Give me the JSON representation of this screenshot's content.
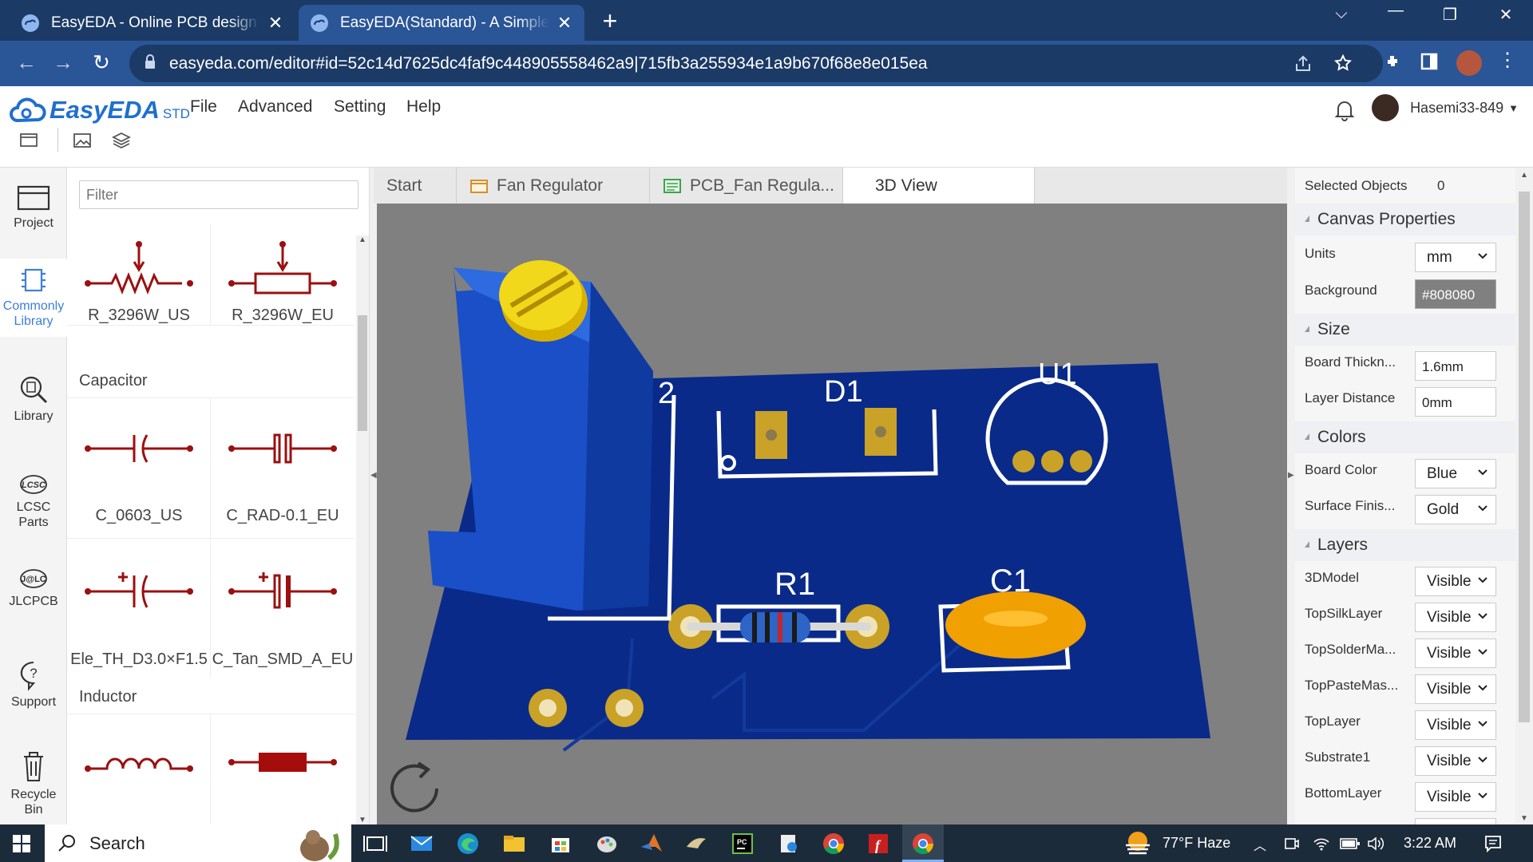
{
  "browser": {
    "tabs": [
      {
        "title": "EasyEDA - Online PCB design & c",
        "close": "✕"
      },
      {
        "title": "EasyEDA(Standard) - A Simple an",
        "close": "✕"
      }
    ],
    "new_tab": "+",
    "url": "easyeda.com/editor#id=52c14d7625dc4faf9c448905558462a9|715fb3a255934e1a9b670f68e8e015ea"
  },
  "app": {
    "logo": "EasyEDA",
    "edition": "STD",
    "menus": [
      "File",
      "Advanced",
      "Setting",
      "Help"
    ],
    "user": "Hasemi33-849"
  },
  "leftnav": [
    {
      "label": "Project",
      "icon": "folder-icon"
    },
    {
      "label": "Commonly Library",
      "icon": "chip-icon"
    },
    {
      "label": "Library",
      "icon": "library-search-icon"
    },
    {
      "label": "LCSC Parts",
      "icon": "lcsc-icon"
    },
    {
      "label": "JLCPCB",
      "icon": "jlcpcb-icon"
    },
    {
      "label": "Support",
      "icon": "help-icon"
    },
    {
      "label": "Recycle Bin",
      "icon": "trash-icon"
    }
  ],
  "library": {
    "filter_placeholder": "Filter",
    "sections": [
      "Capacitor",
      "Inductor"
    ],
    "items": [
      "R_3296W_US",
      "R_3296W_EU",
      "C_0603_US",
      "C_RAD-0.1_EU",
      "Ele_TH_D3.0×F1.5",
      "C_Tan_SMD_A_EU"
    ]
  },
  "doctabs": [
    "Start",
    "Fan Regulator",
    "PCB_Fan Regula...",
    "3D View"
  ],
  "board": {
    "labels": {
      "d1": "D1",
      "u1": "U1",
      "r1": "R1",
      "c1": "C1",
      "r2": "2"
    },
    "colors": {
      "background": "#808080",
      "board": "#0a2a8a",
      "silk": "#ffffff",
      "pad": "#c9a227"
    }
  },
  "props": {
    "selected_label": "Selected Objects",
    "selected_count": "0",
    "canvas_head": "Canvas Properties",
    "units_label": "Units",
    "units_value": "mm",
    "bg_label": "Background",
    "bg_value": "#808080",
    "size_head": "Size",
    "thick_label": "Board Thickn...",
    "thick_value": "1.6mm",
    "dist_label": "Layer Distance",
    "dist_value": "0mm",
    "colors_head": "Colors",
    "board_color_label": "Board Color",
    "board_color_value": "Blue",
    "finish_label": "Surface Finis...",
    "finish_value": "Gold",
    "layers_head": "Layers",
    "layers": [
      {
        "name": "3DModel",
        "value": "Visible"
      },
      {
        "name": "TopSilkLayer",
        "value": "Visible"
      },
      {
        "name": "TopSolderMa...",
        "value": "Visible"
      },
      {
        "name": "TopPasteMas...",
        "value": "Visible"
      },
      {
        "name": "TopLayer",
        "value": "Visible"
      },
      {
        "name": "Substrate1",
        "value": "Visible"
      },
      {
        "name": "BottomLayer",
        "value": "Visible"
      }
    ]
  },
  "taskbar": {
    "search": "Search",
    "weather": "77°F  Haze",
    "time": "3:22 AM"
  }
}
